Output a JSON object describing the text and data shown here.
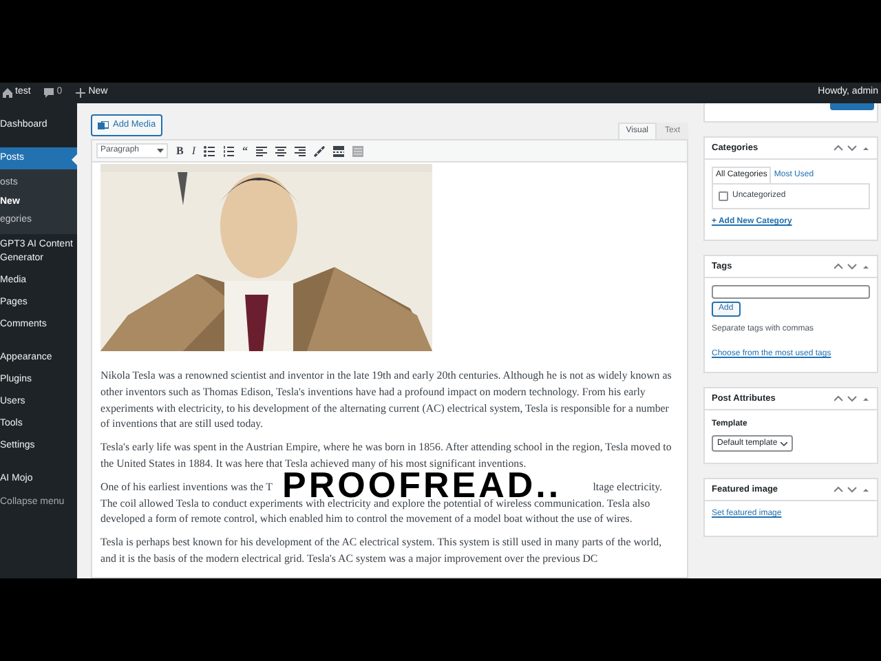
{
  "admin_bar": {
    "site": "test",
    "comments": "0",
    "new": "New",
    "greeting": "Howdy, admin"
  },
  "sidebar": {
    "groups": [
      [
        {
          "label": "Dashboard",
          "selected": false
        }
      ],
      [
        {
          "label": "Posts",
          "selected": true,
          "children": [
            {
              "label": "osts",
              "selected": false
            },
            {
              "label": "New",
              "selected": true
            },
            {
              "label": "egories",
              "selected": false
            }
          ]
        },
        {
          "label": "GPT3 AI Content Generator",
          "selected": false
        },
        {
          "label": "Media",
          "selected": false
        },
        {
          "label": "Pages",
          "selected": false
        },
        {
          "label": "Comments",
          "selected": false
        }
      ],
      [
        {
          "label": "Appearance",
          "selected": false
        },
        {
          "label": "Plugins",
          "selected": false
        },
        {
          "label": "Users",
          "selected": false
        },
        {
          "label": "Tools",
          "selected": false
        },
        {
          "label": "Settings",
          "selected": false
        }
      ],
      [
        {
          "label": "AI Mojo",
          "selected": false
        }
      ]
    ],
    "collapse": "Collapse menu"
  },
  "editor": {
    "add_media": "Add Media",
    "tabs": [
      {
        "label": "Visual",
        "selected": true
      },
      {
        "label": "Text",
        "selected": false
      }
    ],
    "format_select": "Paragraph",
    "toolbar": [
      {
        "kind": "text",
        "label": "B"
      },
      {
        "kind": "text",
        "label": "I"
      },
      {
        "kind": "bullet-list"
      },
      {
        "kind": "numbered-list"
      },
      {
        "kind": "text",
        "label": "“"
      },
      {
        "kind": "align-left"
      },
      {
        "kind": "align-center"
      },
      {
        "kind": "align-right"
      },
      {
        "kind": "link"
      },
      {
        "kind": "more"
      },
      {
        "kind": "toolbar-toggle"
      }
    ],
    "paragraphs": [
      {
        "kind": "text",
        "text": "Nikola Tesla was a renowned scientist and inventor in the late 19th and early 20th centuries. Although he is not as widely known as other inventors such as Thomas Edison, Tesla's inventions have had a profound impact on modern technology. From his early experiments with electricity, to his development of the alternating current (AC) electrical system, Tesla is responsible for a number of inventions that are still used today."
      },
      {
        "kind": "text",
        "text": "Tesla's early life was spent in the Austrian Empire, where he was born in 1856. After attending school in the region, Tesla moved to the United States in 1884. It was here that Tesla achieved many of his most significant inventions."
      },
      {
        "kind": "covered",
        "start": "One of his earliest inventions was the T",
        "end": "ltage electricity.",
        "rest": "The coil allowed Tesla to conduct experiments with electricity and explore the potential of wireless communication. Tesla also developed a form of remote control, which enabled him to control the movement of a model boat without the use of wires."
      },
      {
        "kind": "text",
        "text": "Tesla is perhaps best known for his development of the AC electrical system. This system is still used in many parts of the world, and it is the basis of the modern electrical grid. Tesla's AC system was a major improvement over the previous DC"
      }
    ]
  },
  "panels": [
    {
      "kind": "categories",
      "title": "Categories",
      "tabs": [
        {
          "label": "All Categories",
          "selected": true
        },
        {
          "label": "Most Used",
          "selected": false
        }
      ],
      "items": [
        {
          "label": "Uncategorized",
          "checked": false
        }
      ],
      "link": "+ Add New Category"
    },
    {
      "kind": "tags",
      "title": "Tags",
      "button": "Add",
      "hint": "Separate tags with commas",
      "link": "Choose from the most used tags"
    },
    {
      "kind": "attributes",
      "title": "Post Attributes",
      "label": "Template",
      "select": "Default template"
    },
    {
      "kind": "featured",
      "title": "Featured image",
      "link": "Set featured image"
    }
  ],
  "caption": "PROOFREAD.."
}
